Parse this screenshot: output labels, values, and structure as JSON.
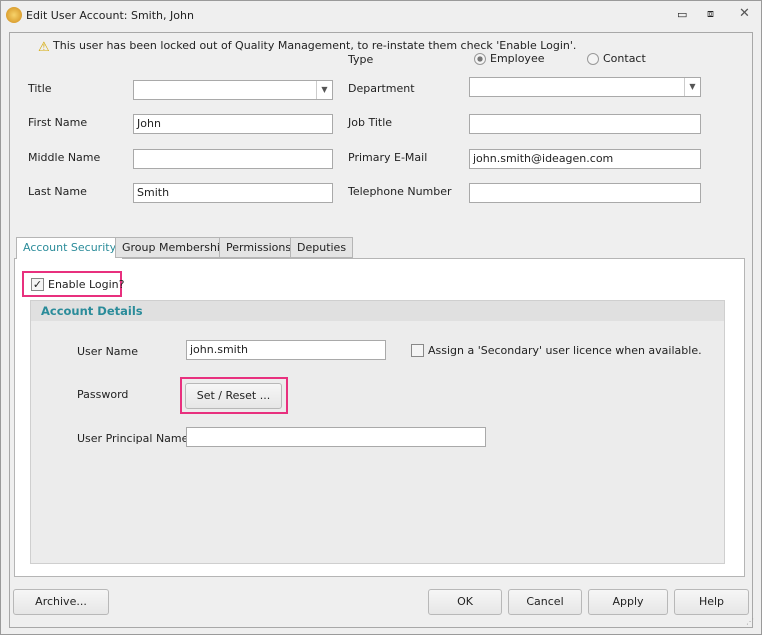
{
  "window": {
    "title": "Edit User Account: Smith, John"
  },
  "warning": "This user has been locked out of Quality Management, to re-instate them check 'Enable Login'.",
  "type": {
    "label": "Type",
    "options": [
      "Employee",
      "Contact"
    ],
    "selected": "Employee"
  },
  "fields": {
    "title": {
      "label": "Title",
      "value": ""
    },
    "first_name": {
      "label": "First Name",
      "value": "John"
    },
    "middle_name": {
      "label": "Middle Name",
      "value": ""
    },
    "last_name": {
      "label": "Last Name",
      "value": "Smith"
    },
    "department": {
      "label": "Department",
      "value": ""
    },
    "job_title": {
      "label": "Job Title",
      "value": ""
    },
    "email": {
      "label": "Primary E-Mail",
      "value": "john.smith@ideagen.com"
    },
    "phone": {
      "label": "Telephone Number",
      "value": ""
    }
  },
  "tabs": [
    "Account Security",
    "Group Membership",
    "Permissions",
    "Deputies"
  ],
  "security": {
    "enable_login": "Enable Login?",
    "enable_login_checked": true,
    "section": "Account Details",
    "user_name_label": "User Name",
    "user_name": "john.smith",
    "secondary": "Assign a 'Secondary' user licence when available.",
    "secondary_checked": false,
    "password_label": "Password",
    "set_reset": "Set / Reset ...",
    "upn_label": "User Principal Name",
    "upn": ""
  },
  "buttons": {
    "archive": "Archive...",
    "ok": "OK",
    "cancel": "Cancel",
    "apply": "Apply",
    "help": "Help"
  }
}
